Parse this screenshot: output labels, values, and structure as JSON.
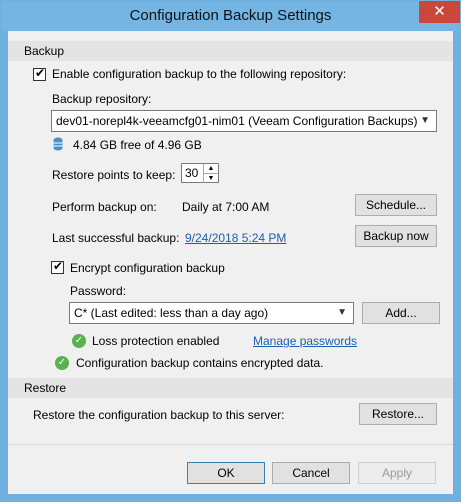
{
  "window": {
    "title": "Configuration Backup Settings",
    "close_glyph": "✕"
  },
  "backup": {
    "section_label": "Backup",
    "enable_label": "Enable configuration backup to the following repository:",
    "repository_label": "Backup repository:",
    "repository_value": "dev01-norepl4k-veeamcfg01-nim01 (Veeam Configuration Backups)",
    "storage_text": "4.84 GB free of 4.96 GB",
    "restore_points_label": "Restore points to keep:",
    "restore_points_value": "30",
    "perform_label": "Perform backup on:",
    "perform_value": "Daily at 7:00 AM",
    "schedule_button": "Schedule...",
    "last_label": "Last successful backup:",
    "last_value": "9/24/2018 5:24 PM",
    "backup_now_button": "Backup now",
    "encrypt_label": "Encrypt configuration backup",
    "password_label": "Password:",
    "password_value": "C* (Last edited: less than a day ago)",
    "add_button": "Add...",
    "loss_protection": "Loss protection enabled",
    "manage_passwords": "Manage passwords",
    "encrypted_note": "Configuration backup contains encrypted data."
  },
  "restore": {
    "section_label": "Restore",
    "description": "Restore the configuration backup to this server:",
    "restore_button": "Restore..."
  },
  "footer": {
    "ok": "OK",
    "cancel": "Cancel",
    "apply": "Apply"
  }
}
